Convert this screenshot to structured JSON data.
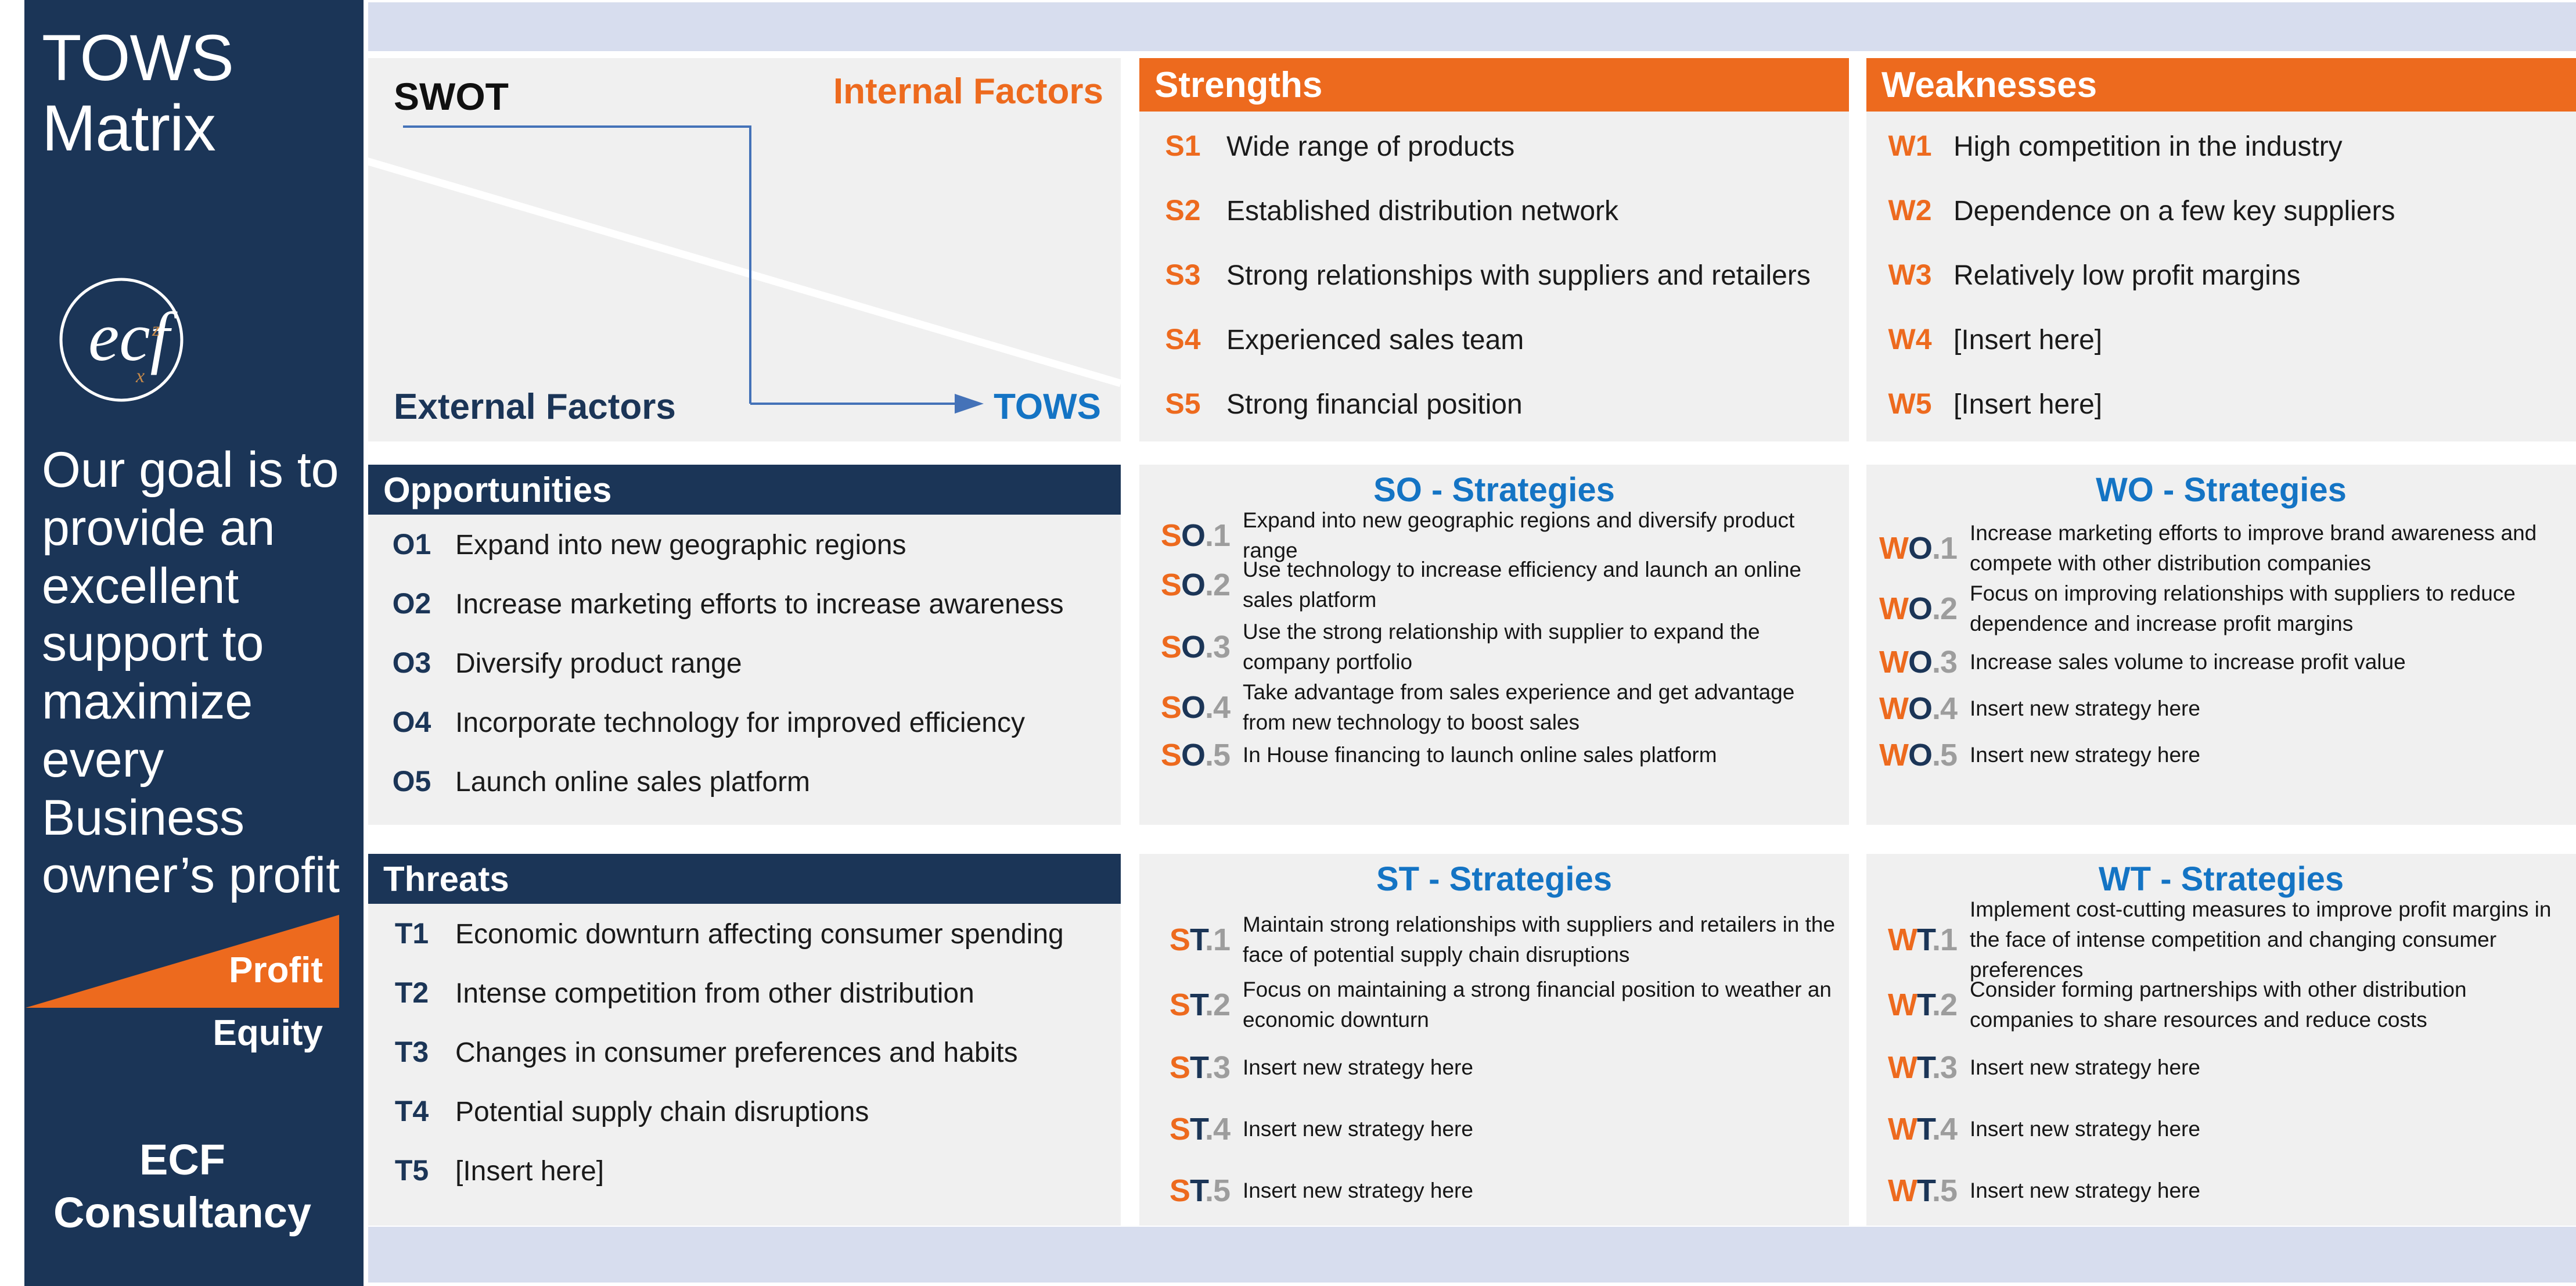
{
  "sidebar": {
    "title_line1": "TOWS",
    "title_line2": "Matrix",
    "logo_name": "ecf",
    "logo_sup": "z",
    "logo_sub": "x",
    "goal_text": "Our goal is to provide an excellent support to maximize every Business owner’s profit",
    "wedge": {
      "profit_label": "Profit",
      "equity_label": "Equity"
    },
    "brand_line1": "ECF",
    "brand_line2": "Consultancy"
  },
  "swot_diagram": {
    "swot_label": "SWOT",
    "internal_label": "Internal Factors",
    "external_label": "External Factors",
    "tows_label": "TOWS"
  },
  "strengths": {
    "header": "Strengths",
    "items": [
      {
        "code": "S1",
        "text": "Wide range of products"
      },
      {
        "code": "S2",
        "text": "Established distribution network"
      },
      {
        "code": "S3",
        "text": "Strong relationships with suppliers and retailers"
      },
      {
        "code": "S4",
        "text": "Experienced sales team"
      },
      {
        "code": "S5",
        "text": "Strong financial position"
      }
    ]
  },
  "weaknesses": {
    "header": "Weaknesses",
    "items": [
      {
        "code": "W1",
        "text": "High competition in the industry"
      },
      {
        "code": "W2",
        "text": "Dependence on a few key suppliers"
      },
      {
        "code": "W3",
        "text": "Relatively low profit margins"
      },
      {
        "code": "W4",
        "text": "[Insert here]"
      },
      {
        "code": "W5",
        "text": "[Insert here]"
      }
    ]
  },
  "opportunities": {
    "header": "Opportunities",
    "items": [
      {
        "code": "O1",
        "text": "Expand into new geographic regions"
      },
      {
        "code": "O2",
        "text": "Increase marketing efforts to increase awareness"
      },
      {
        "code": "O3",
        "text": "Diversify product range"
      },
      {
        "code": "O4",
        "text": "Incorporate technology for improved efficiency"
      },
      {
        "code": "O5",
        "text": "Launch online sales platform"
      }
    ]
  },
  "threats": {
    "header": "Threats",
    "items": [
      {
        "code": "T1",
        "text": "Economic downturn affecting consumer spending"
      },
      {
        "code": "T2",
        "text": "Intense competition from other distribution"
      },
      {
        "code": "T3",
        "text": "Changes in consumer preferences and habits"
      },
      {
        "code": "T4",
        "text": "Potential supply chain disruptions"
      },
      {
        "code": "T5",
        "text": "[Insert here]"
      }
    ]
  },
  "so_strategies": {
    "header": "SO - Strategies",
    "items": [
      {
        "p1": "S",
        "p2": "O",
        "p3": ".1",
        "text": "Expand into new geographic regions and diversify product range"
      },
      {
        "p1": "S",
        "p2": "O",
        "p3": ".2",
        "text": "Use technology to increase efficiency and launch an online sales platform"
      },
      {
        "p1": "S",
        "p2": "O",
        "p3": ".3",
        "text": "Use the strong relationship with supplier to expand the company portfolio"
      },
      {
        "p1": "S",
        "p2": "O",
        "p3": ".4",
        "text": "Take advantage from sales experience and get advantage from new technology to boost sales"
      },
      {
        "p1": "S",
        "p2": "O",
        "p3": ".5",
        "text": "In House financing to launch online sales platform"
      }
    ]
  },
  "wo_strategies": {
    "header": "WO - Strategies",
    "items": [
      {
        "p1": "W",
        "p2": "O",
        "p3": ".1",
        "text": "Increase marketing efforts to improve brand awareness and compete with other distribution companies"
      },
      {
        "p1": "W",
        "p2": "O",
        "p3": ".2",
        "text": "Focus on improving relationships with suppliers to reduce dependence and increase profit margins"
      },
      {
        "p1": "W",
        "p2": "O",
        "p3": ".3",
        "text": "Increase sales volume to increase profit value"
      },
      {
        "p1": "W",
        "p2": "O",
        "p3": ".4",
        "text": "Insert new strategy here"
      },
      {
        "p1": "W",
        "p2": "O",
        "p3": ".5",
        "text": "Insert new strategy here"
      }
    ]
  },
  "st_strategies": {
    "header": "ST - Strategies",
    "items": [
      {
        "p1": "S",
        "p2": "T",
        "p3": ".1",
        "text": "Maintain strong relationships with suppliers and retailers in the face of potential supply chain disruptions"
      },
      {
        "p1": "S",
        "p2": "T",
        "p3": ".2",
        "text": "Focus on maintaining a strong financial position to weather an economic downturn"
      },
      {
        "p1": "S",
        "p2": "T",
        "p3": ".3",
        "text": "Insert new strategy here"
      },
      {
        "p1": "S",
        "p2": "T",
        "p3": ".4",
        "text": "Insert new strategy here"
      },
      {
        "p1": "S",
        "p2": "T",
        "p3": ".5",
        "text": "Insert new strategy here"
      }
    ]
  },
  "wt_strategies": {
    "header": "WT - Strategies",
    "items": [
      {
        "p1": "W",
        "p2": "T",
        "p3": ".1",
        "text": "Implement cost-cutting measures to improve profit margins in the face of intense competition and changing consumer preferences"
      },
      {
        "p1": "W",
        "p2": "T",
        "p3": ".2",
        "text": "Consider forming partnerships with other distribution companies to share resources and reduce costs"
      },
      {
        "p1": "W",
        "p2": "T",
        "p3": ".3",
        "text": "Insert new strategy here"
      },
      {
        "p1": "W",
        "p2": "T",
        "p3": ".4",
        "text": "Insert new strategy here"
      },
      {
        "p1": "W",
        "p2": "T",
        "p3": ".5",
        "text": "Insert new strategy here"
      }
    ]
  },
  "colors": {
    "navy": "#1B3557",
    "orange": "#ED6A1E",
    "blue": "#1474C4",
    "panel_bg": "#F0F0F0",
    "strip": "#D7DDEE",
    "gray_code": "#9D9D9D"
  }
}
